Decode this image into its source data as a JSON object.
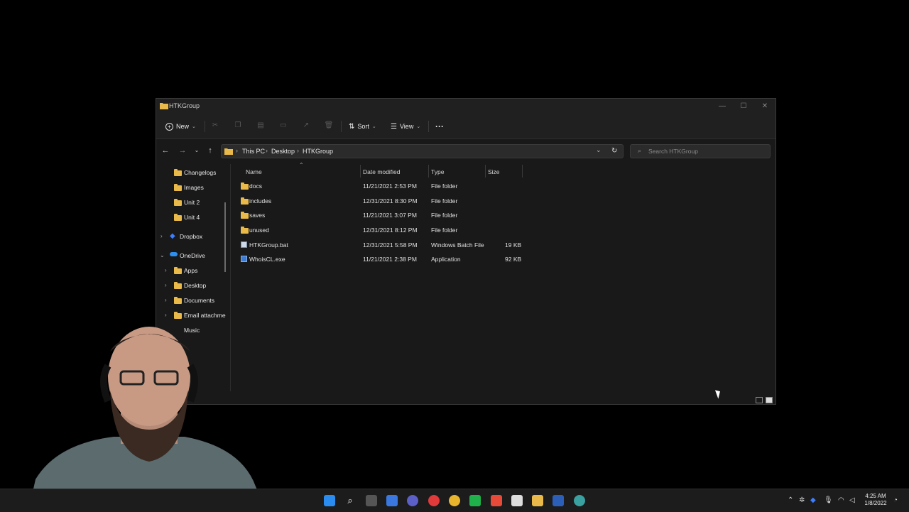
{
  "window": {
    "title": "HTKGroup",
    "minimize": "—",
    "maximize": "☐",
    "close": "✕"
  },
  "toolbar": {
    "new_label": "New",
    "sort_label": "Sort",
    "view_label": "View",
    "more_label": "···"
  },
  "address": {
    "crumbs": [
      "This PC",
      "Desktop",
      "HTKGroup"
    ]
  },
  "search": {
    "placeholder": "Search HTKGroup"
  },
  "sidebar": {
    "items": [
      {
        "label": "Changelogs"
      },
      {
        "label": "Images"
      },
      {
        "label": "Unit 2"
      },
      {
        "label": "Unit 4"
      },
      {
        "label": "Dropbox"
      },
      {
        "label": "OneDrive"
      },
      {
        "label": "Apps"
      },
      {
        "label": "Desktop"
      },
      {
        "label": "Documents"
      },
      {
        "label": "Email attachme"
      },
      {
        "label": "Music"
      }
    ]
  },
  "columns": [
    "Name",
    "Date modified",
    "Type",
    "Size"
  ],
  "files": [
    {
      "name": "docs",
      "date": "11/21/2021 2:53 PM",
      "type": "File folder",
      "size": ""
    },
    {
      "name": "includes",
      "date": "12/31/2021 8:30 PM",
      "type": "File folder",
      "size": ""
    },
    {
      "name": "saves",
      "date": "11/21/2021 3:07 PM",
      "type": "File folder",
      "size": ""
    },
    {
      "name": "unused",
      "date": "12/31/2021 8:12 PM",
      "type": "File folder",
      "size": ""
    },
    {
      "name": "HTKGroup.bat",
      "date": "12/31/2021 5:58 PM",
      "type": "Windows Batch File",
      "size": "19 KB"
    },
    {
      "name": "WhoisCL.exe",
      "date": "11/21/2021 2:38 PM",
      "type": "Application",
      "size": "92 KB"
    }
  ],
  "clock": {
    "time": "4:25 AM",
    "date": "1/8/2022"
  },
  "colors": {
    "folder": "#e9b949",
    "accent": "#0078d4",
    "bg": "#191919"
  }
}
